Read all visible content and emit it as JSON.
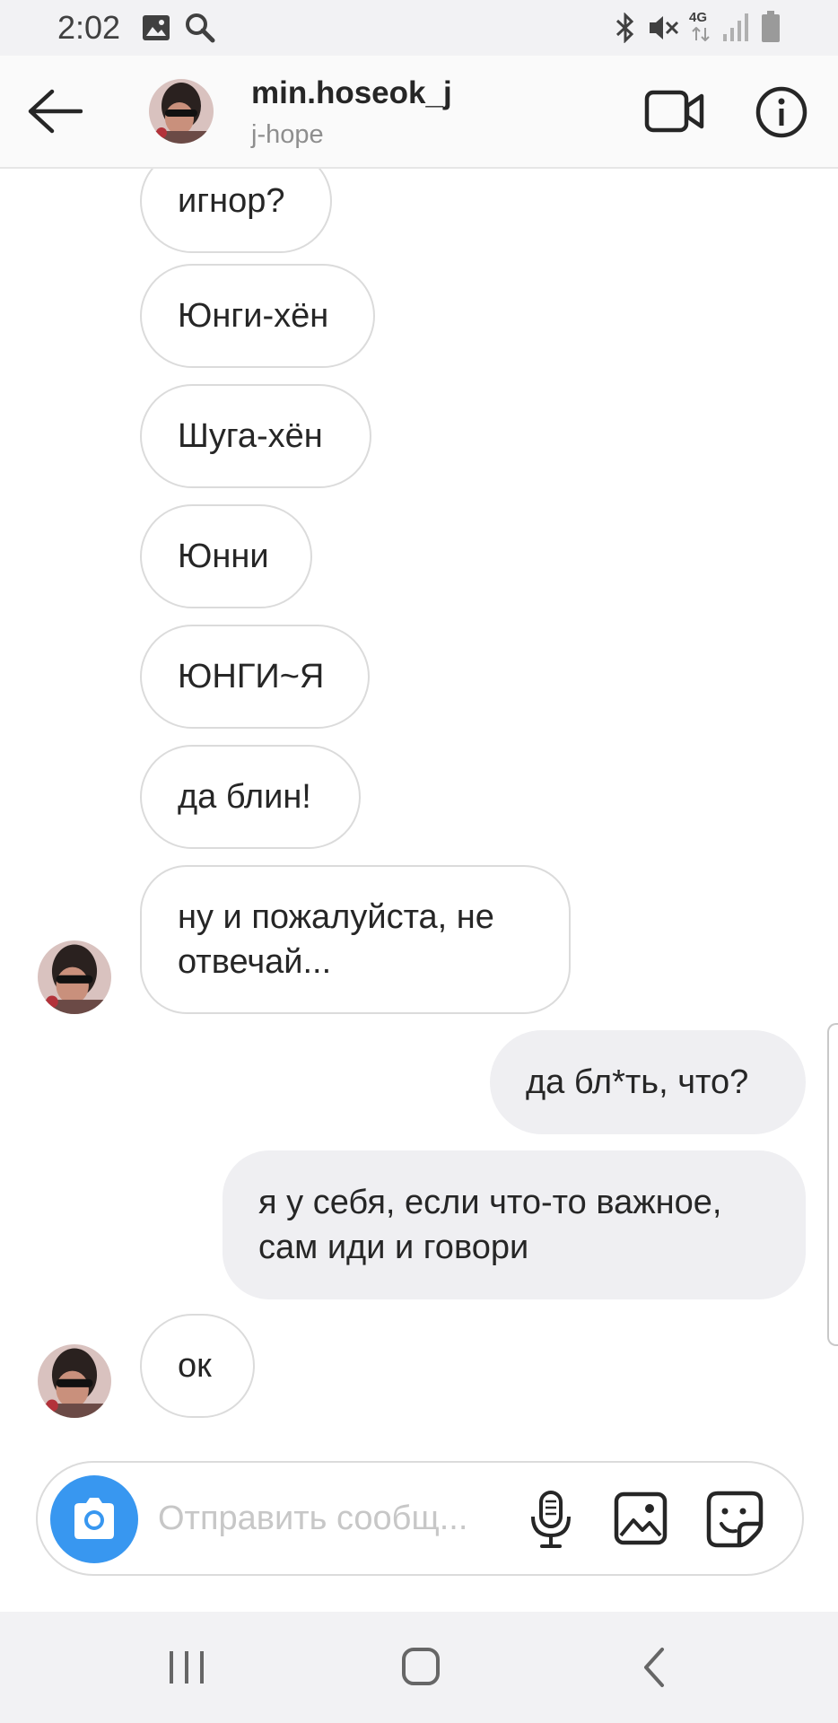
{
  "status_bar": {
    "time": "2:02",
    "network": "4G",
    "icons": [
      "image-icon",
      "search-icon",
      "bluetooth-icon",
      "mute-icon",
      "signal-icon",
      "battery-icon"
    ]
  },
  "header": {
    "username": "min.hoseok_j",
    "subtitle": "j-hope",
    "icons": [
      "back-arrow-icon",
      "video-camera-icon",
      "info-icon"
    ]
  },
  "messages": [
    {
      "side": "in",
      "text": "игнор?"
    },
    {
      "side": "in",
      "text": "Юнги-хён"
    },
    {
      "side": "in",
      "text": "Шуга-хён"
    },
    {
      "side": "in",
      "text": "Юнни"
    },
    {
      "side": "in",
      "text": "ЮНГИ~Я"
    },
    {
      "side": "in",
      "text": "да блин!"
    },
    {
      "side": "in",
      "text": "ну и пожалуйста, не отвечай..."
    },
    {
      "side": "out",
      "text": "да бл*ть, что?"
    },
    {
      "side": "out",
      "text": "я у себя, если что-то важное, сам иди и говори"
    },
    {
      "side": "in",
      "text": "ок"
    }
  ],
  "composer": {
    "placeholder": "Отправить сообщ...",
    "icons": [
      "camera-icon",
      "microphone-icon",
      "gallery-icon",
      "sticker-icon"
    ]
  },
  "nav_bar": {
    "icons": [
      "recent-apps-icon",
      "home-icon",
      "back-icon"
    ]
  },
  "colors": {
    "accent": "#3897f0",
    "outgoing_bubble": "#efeff2",
    "incoming_border": "#dbdbdb",
    "secondary_text": "#8e8e8e"
  }
}
